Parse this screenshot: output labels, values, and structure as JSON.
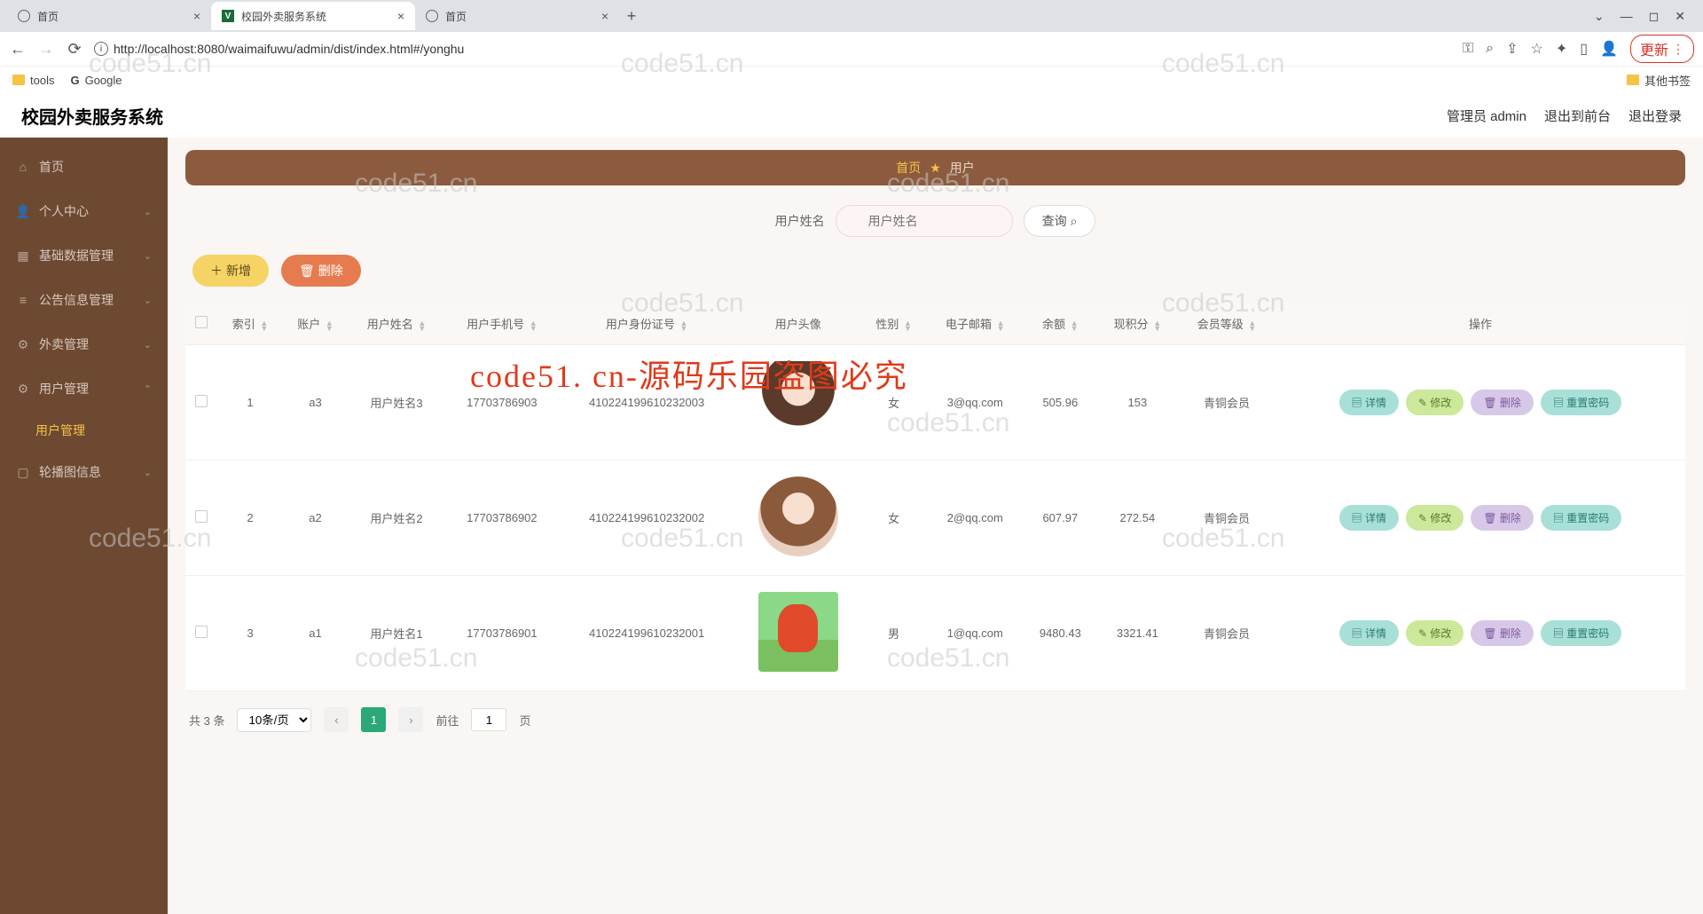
{
  "browser": {
    "tabs": [
      {
        "title": "首页",
        "icon": "globe",
        "active": false
      },
      {
        "title": "校园外卖服务系统",
        "icon": "vlogo",
        "active": true
      },
      {
        "title": "首页",
        "icon": "globe",
        "active": false
      }
    ],
    "url": "http://localhost:8080/waimaifuwu/admin/dist/index.html#/yonghu",
    "update_label": "更新",
    "bookmarks": {
      "tools": "tools",
      "google": "Google",
      "other": "其他书签"
    }
  },
  "header": {
    "title": "校园外卖服务系统",
    "admin": "管理员 admin",
    "front": "退出到前台",
    "logout": "退出登录"
  },
  "sidebar": {
    "items": [
      {
        "label": "首页",
        "icon": "home-icon"
      },
      {
        "label": "个人中心",
        "icon": "user-icon"
      },
      {
        "label": "基础数据管理",
        "icon": "clipboard-icon"
      },
      {
        "label": "公告信息管理",
        "icon": "menu-icon"
      },
      {
        "label": "外卖管理",
        "icon": "gear-icon"
      },
      {
        "label": "用户管理",
        "icon": "gear-icon",
        "expanded": true,
        "children": [
          {
            "label": "用户管理"
          }
        ]
      },
      {
        "label": "轮播图信息",
        "icon": "image-icon"
      }
    ]
  },
  "breadcrumb": {
    "home": "首页",
    "current": "用户"
  },
  "search": {
    "label": "用户姓名",
    "placeholder": "用户姓名",
    "query_btn": "查询"
  },
  "actions": {
    "add": "新增",
    "delete": "删除"
  },
  "table": {
    "columns": [
      "",
      "索引",
      "账户",
      "用户姓名",
      "用户手机号",
      "用户身份证号",
      "用户头像",
      "性别",
      "电子邮箱",
      "余额",
      "现积分",
      "会员等级",
      "操作"
    ],
    "rows": [
      {
        "index": "1",
        "account": "a3",
        "name": "用户姓名3",
        "phone": "17703786903",
        "idcard": "410224199610232003",
        "gender": "女",
        "email": "3@qq.com",
        "balance": "505.96",
        "points": "153",
        "level": "青铜会员",
        "avatar_class": "av1"
      },
      {
        "index": "2",
        "account": "a2",
        "name": "用户姓名2",
        "phone": "17703786902",
        "idcard": "410224199610232002",
        "gender": "女",
        "email": "2@qq.com",
        "balance": "607.97",
        "points": "272.54",
        "level": "青铜会员",
        "avatar_class": "av2 round"
      },
      {
        "index": "3",
        "account": "a1",
        "name": "用户姓名1",
        "phone": "17703786901",
        "idcard": "410224199610232001",
        "gender": "男",
        "email": "1@qq.com",
        "balance": "9480.43",
        "points": "3321.41",
        "level": "青铜会员",
        "avatar_class": "av3"
      }
    ],
    "ops": {
      "detail": "详情",
      "edit": "修改",
      "delete": "删除",
      "reset": "重置密码"
    }
  },
  "pagination": {
    "total": "共 3 条",
    "per_page": "10条/页",
    "goto": "前往",
    "page": "1",
    "page_suffix": "页"
  },
  "watermark": "code51.cn",
  "watermark_red": "code51. cn-源码乐园盗图必究"
}
